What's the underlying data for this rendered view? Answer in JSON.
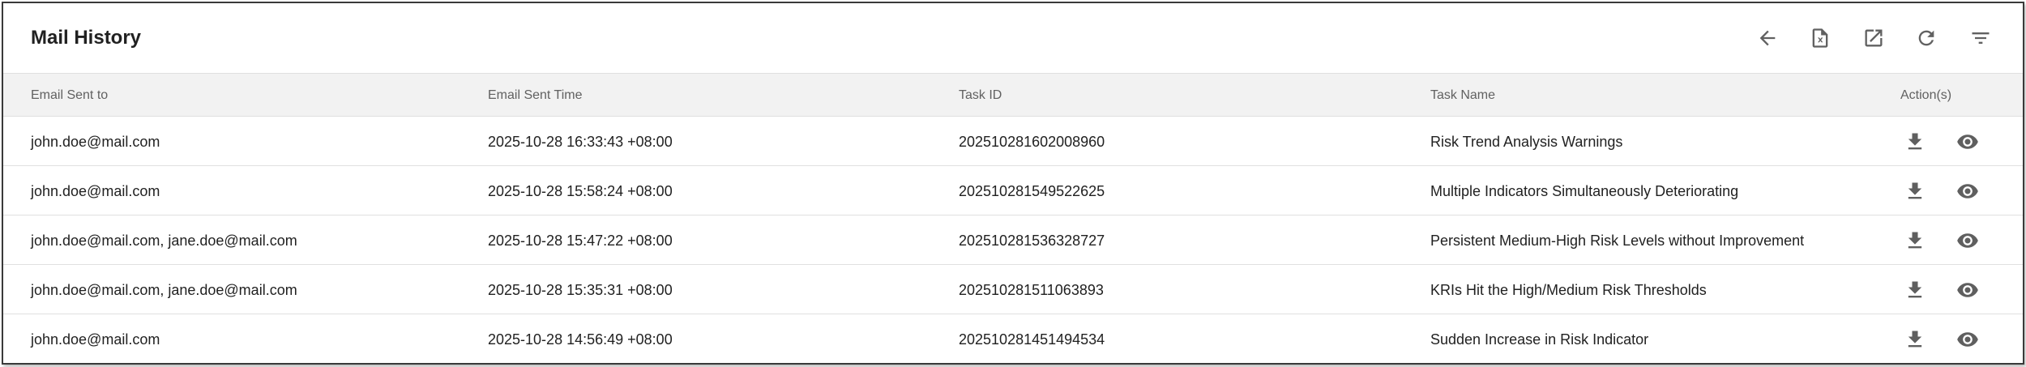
{
  "header": {
    "title": "Mail History",
    "toolbar": [
      {
        "name": "back-icon",
        "label": "Back"
      },
      {
        "name": "export-file-icon",
        "label": "Export"
      },
      {
        "name": "open-external-icon",
        "label": "Open in new window"
      },
      {
        "name": "refresh-icon",
        "label": "Refresh"
      },
      {
        "name": "filter-icon",
        "label": "Filter"
      }
    ]
  },
  "table": {
    "columns": [
      "Email Sent to",
      "Email Sent Time",
      "Task ID",
      "Task Name",
      "Action(s)"
    ],
    "rows": [
      {
        "email": "john.doe@mail.com",
        "time": "2025-10-28 16:33:43 +08:00",
        "task_id": "202510281602008960",
        "task_name": "Risk Trend Analysis Warnings"
      },
      {
        "email": "john.doe@mail.com",
        "time": "2025-10-28 15:58:24 +08:00",
        "task_id": "202510281549522625",
        "task_name": "Multiple Indicators Simultaneously Deteriorating"
      },
      {
        "email": "john.doe@mail.com, jane.doe@mail.com",
        "time": "2025-10-28 15:47:22 +08:00",
        "task_id": "202510281536328727",
        "task_name": "Persistent Medium-High Risk Levels without Improvement"
      },
      {
        "email": "john.doe@mail.com, jane.doe@mail.com",
        "time": "2025-10-28 15:35:31 +08:00",
        "task_id": "202510281511063893",
        "task_name": "KRIs Hit the High/Medium Risk Thresholds"
      },
      {
        "email": "john.doe@mail.com",
        "time": "2025-10-28 14:56:49 +08:00",
        "task_id": "202510281451494534",
        "task_name": "Sudden Increase in Risk Indicator"
      }
    ],
    "row_actions": [
      "download-icon",
      "view-icon"
    ]
  }
}
